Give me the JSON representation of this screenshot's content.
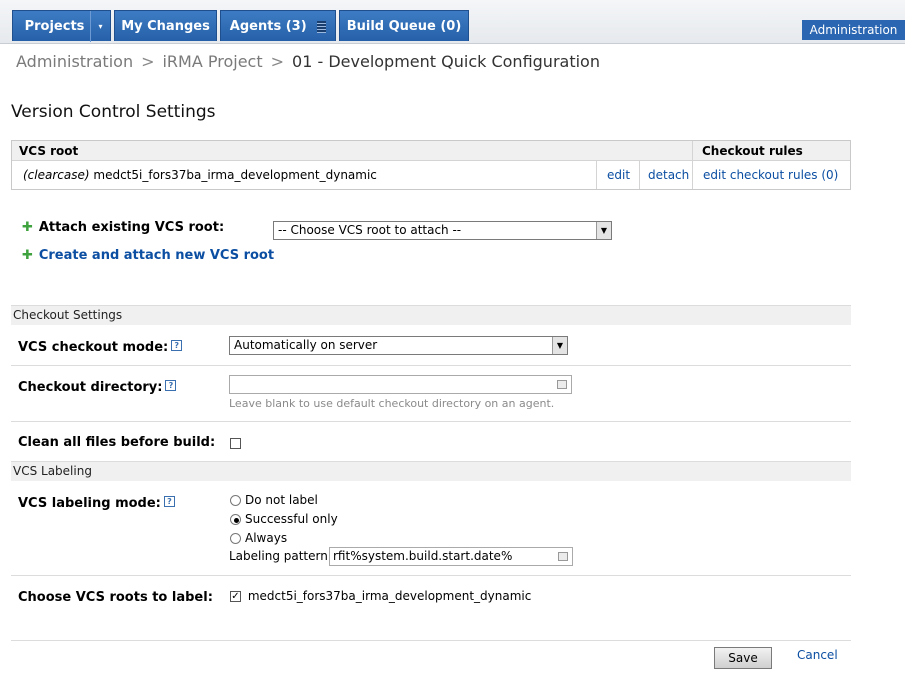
{
  "nav": {
    "projects": "Projects",
    "my_changes": "My Changes",
    "agents": "Agents (3)",
    "build_queue": "Build Queue (0)",
    "administration": "Administration"
  },
  "breadcrumb": {
    "items": [
      "Administration",
      "iRMA Project",
      "01 - Development Quick Configuration"
    ],
    "separator": ">"
  },
  "page_title": "Version Control Settings",
  "vcs_table": {
    "headers": {
      "vcs_root": "VCS root",
      "checkout_rules": "Checkout rules"
    },
    "row": {
      "type": "(clearcase)",
      "name": "medct5i_fors37ba_irma_development_dynamic",
      "edit": "edit",
      "detach": "detach",
      "edit_rules": "edit checkout rules (0)"
    }
  },
  "attach": {
    "label": "Attach existing VCS root:",
    "select_value": "-- Choose VCS root to attach --",
    "create_link": "Create and attach new VCS root"
  },
  "checkout_settings": {
    "section_title": "Checkout Settings",
    "mode_label": "VCS checkout mode:",
    "mode_value": "Automatically on server",
    "dir_label": "Checkout directory:",
    "dir_value": "",
    "dir_hint": "Leave blank to use default checkout directory on an agent.",
    "clean_label": "Clean all files before build:",
    "clean_checked": false
  },
  "labeling": {
    "section_title": "VCS Labeling",
    "mode_label": "VCS labeling mode:",
    "options": [
      "Do not label",
      "Successful only",
      "Always"
    ],
    "selected": "Successful only",
    "pattern_label": "Labeling pattern:",
    "pattern_value": "rfit%system.build.start.date%",
    "roots_label": "Choose VCS roots to label:",
    "root_item": "medct5i_fors37ba_irma_development_dynamic",
    "root_checked": true
  },
  "actions": {
    "save": "Save",
    "cancel": "Cancel"
  },
  "colors": {
    "nav_blue": "#2a66b2",
    "link": "#0b4ea2",
    "plus_green": "#3ea33e"
  }
}
